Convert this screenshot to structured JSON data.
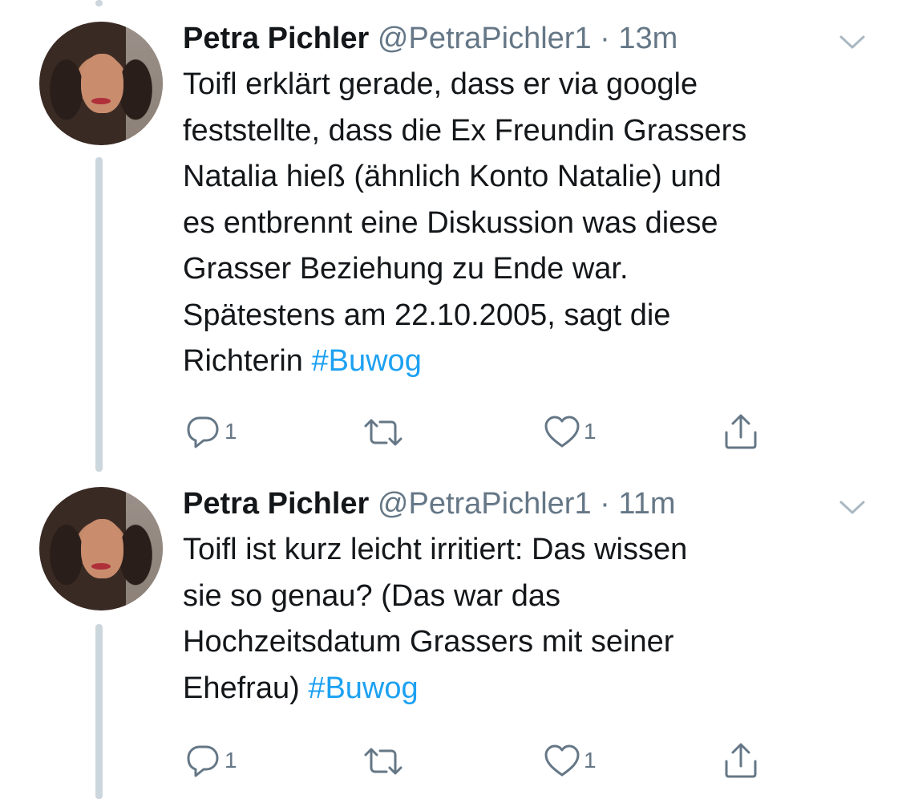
{
  "tweets": [
    {
      "author_name": "Petra Pichler",
      "handle": "@PetraPichler1",
      "separator": " · ",
      "time": "13m",
      "body_lines": [
        "Toifl erklärt gerade, dass er via google",
        "feststellte, dass die Ex Freundin Grassers",
        "Natalia hieß (ähnlich Konto Natalie) und",
        "es entbrennt eine Diskussion was diese",
        "Grasser Beziehung zu Ende war.",
        "Spätestens am 22.10.2005, sagt die",
        "Richterin "
      ],
      "hashtag": "#Buwog",
      "reply_count": "1",
      "like_count": "1"
    },
    {
      "author_name": "Petra Pichler",
      "handle": "@PetraPichler1",
      "separator": " · ",
      "time": "11m",
      "body_lines": [
        "Toifl ist  kurz leicht irritiert: Das wissen",
        "sie so genau? (Das war das",
        "Hochzeitsdatum Grassers mit seiner",
        "Ehefrau) "
      ],
      "hashtag": "#Buwog",
      "reply_count": "1",
      "like_count": "1"
    }
  ],
  "icons": {
    "reply": "reply-icon",
    "retweet": "retweet-icon",
    "like": "heart-icon",
    "share": "share-icon",
    "menu": "chevron-down-icon"
  },
  "colors": {
    "text": "#14171a",
    "secondary": "#657786",
    "link": "#1da1f2",
    "thread_line": "#ccd6dd"
  }
}
